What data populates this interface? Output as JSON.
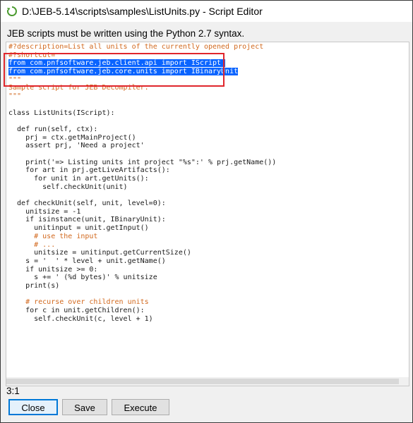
{
  "window": {
    "title": "D:\\JEB-5.14\\scripts\\samples\\ListUnits.py - Script Editor"
  },
  "info_text": "JEB scripts must be written using the Python 2.7 syntax.",
  "editor": {
    "lines": [
      {
        "text": "#?description=List all units of the currently opened project",
        "style": "comment"
      },
      {
        "text": "#?shortcut=",
        "style": "comment"
      },
      {
        "text": "from com.pnfsoftware.jeb.client.api import IScript ",
        "style": "selected"
      },
      {
        "text": "from com.pnfsoftware.jeb.core.units import IBinaryUnit",
        "style": "selected"
      },
      {
        "text": "\"\"\"",
        "style": "comment"
      },
      {
        "text": "Sample script for JEB Decompiler.",
        "style": "comment"
      },
      {
        "text": "\"\"\"",
        "style": "comment"
      },
      {
        "text": "",
        "style": "plain"
      },
      {
        "text": "class ListUnits(IScript):",
        "style": "plain"
      },
      {
        "text": "",
        "style": "plain"
      },
      {
        "text": "  def run(self, ctx):",
        "style": "plain"
      },
      {
        "text": "    prj = ctx.getMainProject()",
        "style": "plain"
      },
      {
        "text": "    assert prj, 'Need a project'",
        "style": "plain"
      },
      {
        "text": "",
        "style": "plain"
      },
      {
        "text": "    print('=> Listing units int project \"%s\":' % prj.getName())",
        "style": "plain"
      },
      {
        "text": "    for art in prj.getLiveArtifacts():",
        "style": "plain"
      },
      {
        "text": "      for unit in art.getUnits():",
        "style": "plain"
      },
      {
        "text": "        self.checkUnit(unit)",
        "style": "plain"
      },
      {
        "text": "",
        "style": "plain"
      },
      {
        "text": "  def checkUnit(self, unit, level=0):",
        "style": "plain"
      },
      {
        "text": "    unitsize = -1",
        "style": "plain"
      },
      {
        "text": "    if isinstance(unit, IBinaryUnit):",
        "style": "plain"
      },
      {
        "text": "      unitinput = unit.getInput()",
        "style": "plain"
      },
      {
        "text": "      # use the input",
        "style": "comment"
      },
      {
        "text": "      # ...",
        "style": "comment"
      },
      {
        "text": "      unitsize = unitinput.getCurrentSize()",
        "style": "plain"
      },
      {
        "text": "    s = '  ' * level + unit.getName()",
        "style": "plain"
      },
      {
        "text": "    if unitsize >= 0:",
        "style": "plain"
      },
      {
        "text": "      s += ' (%d bytes)' % unitsize",
        "style": "plain"
      },
      {
        "text": "    print(s)",
        "style": "plain"
      },
      {
        "text": "",
        "style": "plain"
      },
      {
        "text": "    # recurse over children units",
        "style": "comment"
      },
      {
        "text": "    for c in unit.getChildren():",
        "style": "plain"
      },
      {
        "text": "      self.checkUnit(c, level + 1)",
        "style": "plain"
      }
    ]
  },
  "status": {
    "cursor_position": "3:1"
  },
  "buttons": {
    "close_label": "Close",
    "save_label": "Save",
    "execute_label": "Execute"
  },
  "colors": {
    "selection": "#0a64ff",
    "comment": "#d2691e",
    "annotation_box": "#e0262c"
  },
  "icons": {
    "title": "refresh-circle-icon"
  }
}
